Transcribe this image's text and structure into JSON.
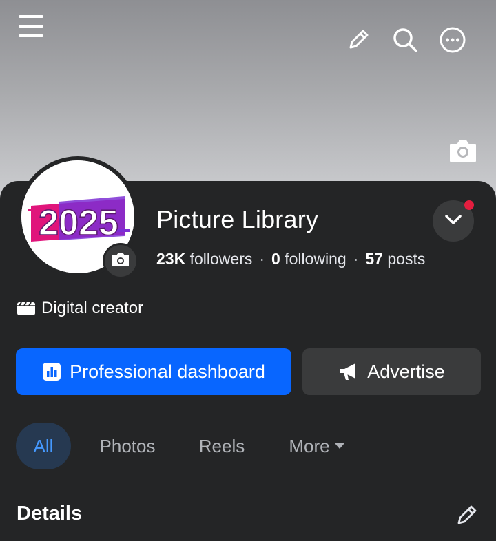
{
  "header": {
    "menu_icon": "hamburger-menu-icon",
    "edit_icon": "pencil-icon",
    "search_icon": "search-icon",
    "more_icon": "more-options-icon",
    "cover_camera_icon": "camera-icon"
  },
  "profile": {
    "avatar_text": "2025",
    "name": "Picture Library",
    "stats": {
      "followers_count": "23K",
      "followers_label": "followers",
      "following_count": "0",
      "following_label": "following",
      "posts_count": "57",
      "posts_label": "posts",
      "separator": "·"
    },
    "category": "Digital creator"
  },
  "actions": {
    "primary_label": "Professional dashboard",
    "secondary_label": "Advertise"
  },
  "tabs": [
    {
      "label": "All",
      "active": true
    },
    {
      "label": "Photos",
      "active": false
    },
    {
      "label": "Reels",
      "active": false
    },
    {
      "label": "More",
      "active": false
    }
  ],
  "section": {
    "title": "Details"
  },
  "colors": {
    "primary": "#0866ff",
    "background": "#242526",
    "active_tab": "#4599ff",
    "notification": "#e41e3f"
  }
}
